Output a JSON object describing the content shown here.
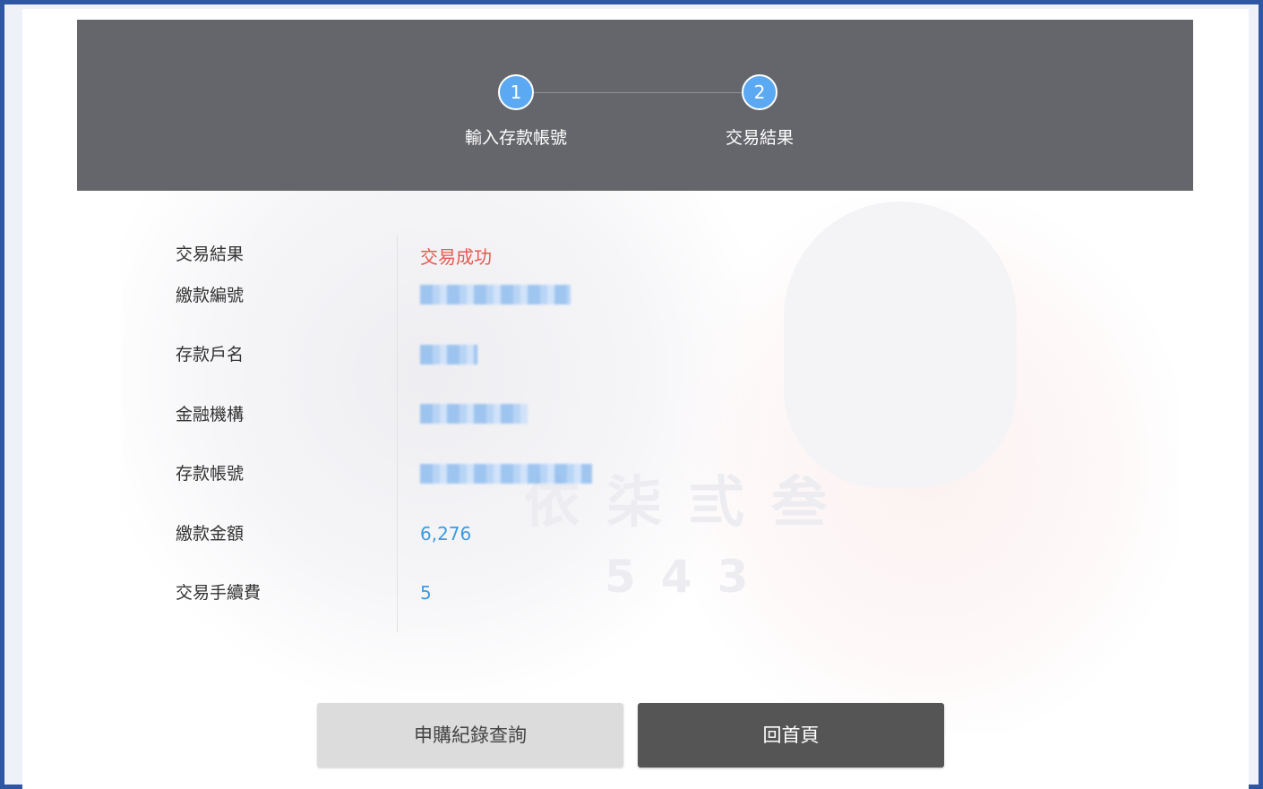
{
  "steps": [
    {
      "number": "1",
      "label": "輸入存款帳號"
    },
    {
      "number": "2",
      "label": "交易結果"
    }
  ],
  "details": {
    "result_label": "交易結果",
    "result_value": "交易成功",
    "payment_no_label": "繳款編號",
    "account_name_label": "存款戶名",
    "bank_label": "金融機構",
    "account_no_label": "存款帳號",
    "amount_label": "繳款金額",
    "amount_value": "6,276",
    "fee_label": "交易手續費",
    "fee_value": "5"
  },
  "buttons": {
    "query": "申購紀錄查詢",
    "home": "回首頁"
  },
  "watermark": {
    "text": "依柒弎叁",
    "number": "543"
  },
  "colors": {
    "frame": "#2e56a3",
    "header_bg": "#65666b",
    "step_circle": "#5aa9f2",
    "success": "#e55a4e",
    "value": "#3d9be0",
    "query_button": "#dcdcdc",
    "home_button": "#555555"
  }
}
